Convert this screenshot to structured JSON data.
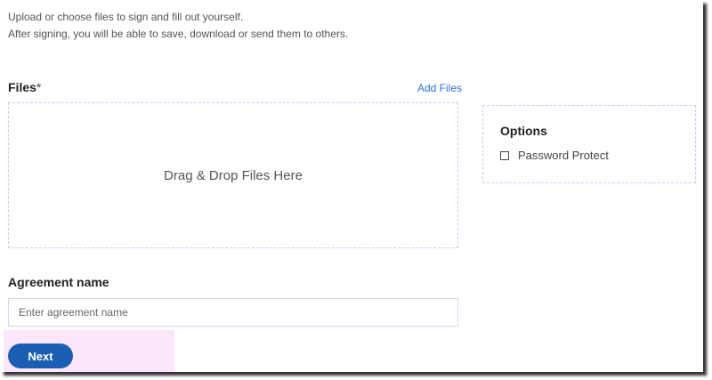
{
  "intro": {
    "line1": "Upload or choose files to sign and fill out yourself.",
    "line2": "After signing, you will be able to save, download or send them to others."
  },
  "files": {
    "label": "Files",
    "required": "*",
    "add_files": "Add Files",
    "drop_text": "Drag & Drop Files Here"
  },
  "options": {
    "title": "Options",
    "password_protect": "Password Protect",
    "password_protect_checked": false
  },
  "agreement": {
    "label": "Agreement name",
    "placeholder": "Enter agreement name",
    "value": ""
  },
  "next_label": "Next"
}
